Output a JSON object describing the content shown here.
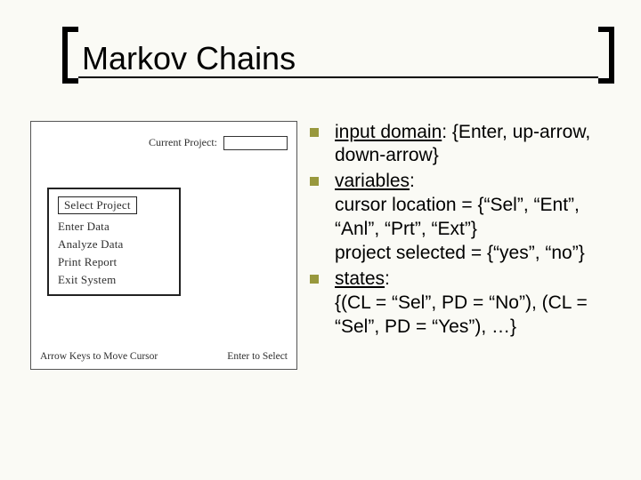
{
  "title": "Markov Chains",
  "figure": {
    "current_project_label": "Current Project:",
    "menu": {
      "items": [
        "Select Project",
        "Enter Data",
        "Analyze Data",
        "Print Report",
        "Exit System"
      ],
      "selected_index": 0
    },
    "hint_left": "Arrow Keys to Move Cursor",
    "hint_right": "Enter to Select"
  },
  "bullets": [
    {
      "label": "input domain",
      "text": ": {Enter, up-arrow, down-arrow}",
      "sub": []
    },
    {
      "label": "variables",
      "text": ":",
      "sub": [
        "cursor location = {“Sel”, “Ent”, “Anl”, “Prt”, “Ext”}",
        "project selected = {“yes”, “no”}"
      ]
    },
    {
      "label": "states",
      "text": ":",
      "sub": [
        "{(CL = “Sel”, PD = “No”), (CL = “Sel”, PD = “Yes”), …}"
      ]
    }
  ]
}
